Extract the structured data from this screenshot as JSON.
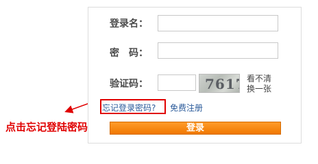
{
  "form": {
    "username_label": "登录名：",
    "password_label": "密　码：",
    "captcha_label": "验证码：",
    "username_value": "",
    "password_value": "",
    "captcha_value": "",
    "captcha_image_text": "7617",
    "refresh_line1": "看不清",
    "refresh_line2": "换一张",
    "forgot_link": "忘记登录密码?",
    "register_link": "免费注册",
    "login_button": "登录"
  },
  "annotation": {
    "text": "点击忘记登陆密码",
    "color": "#e00000"
  },
  "colors": {
    "button": "#f07800",
    "link": "#2a5a9a"
  }
}
